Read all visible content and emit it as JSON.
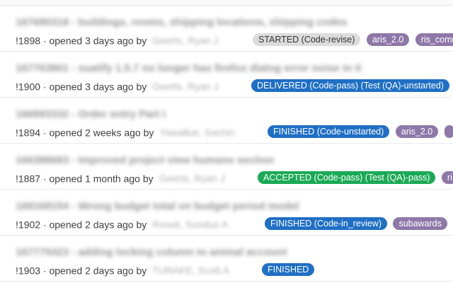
{
  "merge_requests": [
    {
      "title": "167680318 - buildings, rooms, shipping locations, shipping codes",
      "iid": "!1898",
      "opened_text": "· opened 3 days ago by",
      "author": "Geerts, Ryan J",
      "labels": [
        {
          "text": "STARTED (Code-revise)",
          "style": "grey"
        },
        {
          "text": "aris_2.0",
          "style": "purple"
        },
        {
          "text": "ris_comm",
          "style": "purple"
        }
      ]
    },
    {
      "title": "167763801 - suatify 1.5.7 no longer has firefox dialog error noise in it",
      "iid": "!1900",
      "opened_text": "· opened 3 days ago by",
      "author": "Geerts, Ryan J",
      "labels": [
        {
          "text": "DELIVERED (Code-pass) (Test (QA)-unstarted)",
          "style": "blue"
        }
      ]
    },
    {
      "title": "166893332 - Order entry Part I",
      "iid": "!1894",
      "opened_text": "· opened 2 weeks ago by",
      "author": "Yawalkar, Sachin",
      "labels": [
        {
          "text": "FINISHED (Code-unstarted)",
          "style": "blue"
        },
        {
          "text": "aris_2.0",
          "style": "purple"
        },
        {
          "text": "",
          "style": "purple"
        }
      ]
    },
    {
      "title": "166388683 - Improved project view humans section",
      "iid": "!1887",
      "opened_text": "· opened 1 month ago by",
      "author": "Geerts, Ryan J",
      "labels": [
        {
          "text": "ACCEPTED (Code-pass) (Test (QA)-pass)",
          "style": "green"
        },
        {
          "text": "ri",
          "style": "purple"
        }
      ]
    },
    {
      "title": "168168154 - Wrong budget total on budget period model",
      "iid": "!1902",
      "opened_text": "· opened 2 days ago by",
      "author": "Rosoli, Sundus A",
      "labels": [
        {
          "text": "FINISHED (Code-in_review)",
          "style": "blue"
        },
        {
          "text": "subawards",
          "style": "purple"
        }
      ]
    },
    {
      "title": "167775423 - adding locking column to animal account",
      "iid": "!1903",
      "opened_text": "· opened 2 days ago by",
      "author": "TURAKE, Scott A",
      "labels": [
        {
          "text": "FINISHED",
          "style": "blue"
        }
      ]
    }
  ]
}
